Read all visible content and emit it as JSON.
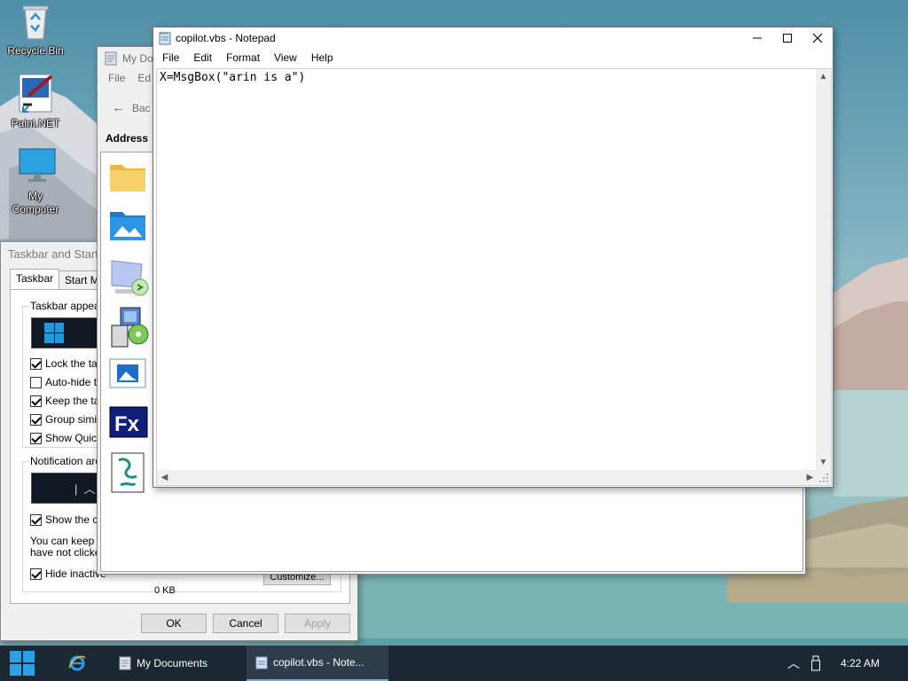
{
  "desktop": {
    "icons": [
      {
        "label": "Recycle Bin",
        "icon": "recycle-bin-icon"
      },
      {
        "label": "Paint.NET",
        "icon": "paint-net-icon"
      },
      {
        "label": "My Computer",
        "icon": "monitor-icon"
      }
    ]
  },
  "taskbar_dialog": {
    "title": "Taskbar and Start",
    "tabs": [
      "Taskbar",
      "Start Me"
    ],
    "group_appearance": "Taskbar appeara",
    "options": [
      {
        "label": "Lock the task",
        "checked": true
      },
      {
        "label": "Auto-hide the",
        "checked": false
      },
      {
        "label": "Keep the tas",
        "checked": true
      },
      {
        "label": "Group similar",
        "checked": true
      },
      {
        "label": "Show Quick",
        "checked": true
      }
    ],
    "group_notification": "Notification area",
    "show_clock": "Show the clo",
    "info_line1": "You can keep th",
    "info_line2": "have not clicked",
    "hide_inactive": "Hide inactive",
    "customize_label": "Customize...",
    "ok_label": "OK",
    "cancel_label": "Cancel",
    "apply_label": "Apply"
  },
  "explorer": {
    "title": "My Doc",
    "menu": [
      "File",
      "Ed"
    ],
    "back_label": "Bac",
    "address_label": "Address",
    "items": [
      {
        "icon": "folder-icon"
      },
      {
        "icon": "pictures-folder-icon"
      },
      {
        "icon": "remote-desktop-icon"
      },
      {
        "icon": "installer-icon"
      },
      {
        "icon": "photos-app-icon"
      },
      {
        "icon": "fx-app-icon"
      },
      {
        "icon": "script-file-icon"
      }
    ],
    "size_text": "0 KB"
  },
  "notepad": {
    "title": "copilot.vbs - Notepad",
    "menu": [
      "File",
      "Edit",
      "Format",
      "View",
      "Help"
    ],
    "content": "X=MsgBox(\"arin is a\")"
  },
  "taskbar": {
    "tasks": [
      {
        "label": "My Documents",
        "icon": "explorer-window-icon"
      },
      {
        "label": "copilot.vbs - Note...",
        "icon": "notepad-icon"
      }
    ],
    "clock": "4:22 AM"
  }
}
